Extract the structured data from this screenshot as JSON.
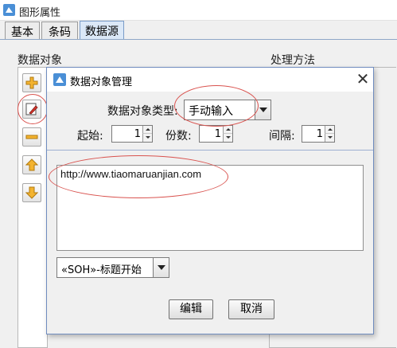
{
  "window": {
    "title": "图形属性"
  },
  "tabs": [
    {
      "label": "基本",
      "active": false
    },
    {
      "label": "条码",
      "active": false
    },
    {
      "label": "数据源",
      "active": true
    }
  ],
  "sections": {
    "data_object_label": "数据对象",
    "processing_label": "处理方法"
  },
  "side_buttons": [
    {
      "icon": "add-icon"
    },
    {
      "icon": "edit-icon"
    },
    {
      "icon": "remove-icon"
    },
    {
      "icon": "move-up-icon"
    },
    {
      "icon": "move-down-icon"
    }
  ],
  "dialog": {
    "title": "数据对象管理",
    "close_glyph": "✕",
    "type_label": "数据对象类型:",
    "type_value": "手动输入",
    "start_label": "起始:",
    "start_value": "1",
    "copies_label": "份数:",
    "copies_value": "1",
    "interval_label": "间隔:",
    "interval_value": "1",
    "text_content": "http://www.tiaomaruanjian.com",
    "insert_combo_value": "«SOH»-标题开始",
    "edit_button": "编辑",
    "cancel_button": "取消"
  },
  "colors": {
    "accent": "#7a9cc7",
    "annotation": "#d9534f"
  }
}
